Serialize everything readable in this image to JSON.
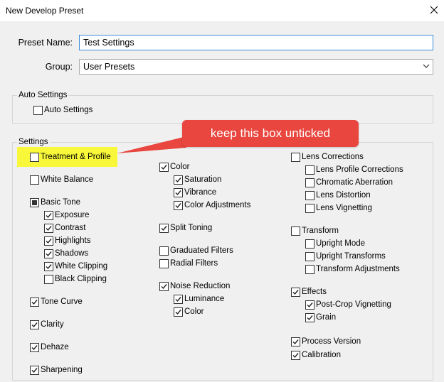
{
  "window": {
    "title": "New Develop Preset"
  },
  "preset_name": {
    "label": "Preset Name:",
    "value": "Test Settings"
  },
  "group": {
    "label": "Group:",
    "value": "User Presets"
  },
  "auto_settings": {
    "legend": "Auto Settings",
    "checkbox": {
      "label": "Auto Settings",
      "checked": false
    }
  },
  "settings": {
    "legend": "Settings",
    "col1": [
      {
        "label": "Treatment & Profile",
        "state": "unchecked"
      },
      {
        "label": "White Balance",
        "state": "unchecked"
      },
      {
        "label": "Basic Tone",
        "state": "partial"
      },
      {
        "label": "Exposure",
        "state": "checked"
      },
      {
        "label": "Contrast",
        "state": "checked"
      },
      {
        "label": "Highlights",
        "state": "checked"
      },
      {
        "label": "Shadows",
        "state": "checked"
      },
      {
        "label": "White Clipping",
        "state": "checked"
      },
      {
        "label": "Black Clipping",
        "state": "unchecked"
      },
      {
        "label": "Tone Curve",
        "state": "checked"
      },
      {
        "label": "Clarity",
        "state": "checked"
      },
      {
        "label": "Dehaze",
        "state": "checked"
      },
      {
        "label": "Sharpening",
        "state": "checked"
      }
    ],
    "col2": [
      {
        "label": "Color",
        "state": "checked"
      },
      {
        "label": "Saturation",
        "state": "checked"
      },
      {
        "label": "Vibrance",
        "state": "checked"
      },
      {
        "label": "Color Adjustments",
        "state": "checked"
      },
      {
        "label": "Split Toning",
        "state": "checked"
      },
      {
        "label": "Graduated Filters",
        "state": "unchecked"
      },
      {
        "label": "Radial Filters",
        "state": "unchecked"
      },
      {
        "label": "Noise Reduction",
        "state": "checked"
      },
      {
        "label": "Luminance",
        "state": "checked"
      },
      {
        "label": "Color",
        "state": "checked"
      }
    ],
    "col3": [
      {
        "label": "Lens Corrections",
        "state": "unchecked"
      },
      {
        "label": "Lens Profile Corrections",
        "state": "unchecked"
      },
      {
        "label": "Chromatic Aberration",
        "state": "unchecked"
      },
      {
        "label": "Lens Distortion",
        "state": "unchecked"
      },
      {
        "label": "Lens Vignetting",
        "state": "unchecked"
      },
      {
        "label": "Transform",
        "state": "unchecked"
      },
      {
        "label": "Upright Mode",
        "state": "unchecked"
      },
      {
        "label": "Upright Transforms",
        "state": "unchecked"
      },
      {
        "label": "Transform Adjustments",
        "state": "unchecked"
      },
      {
        "label": "Effects",
        "state": "checked"
      },
      {
        "label": "Post-Crop Vignetting",
        "state": "checked"
      },
      {
        "label": "Grain",
        "state": "checked"
      },
      {
        "label": "Process Version",
        "state": "checked"
      },
      {
        "label": "Calibration",
        "state": "checked"
      }
    ]
  },
  "annotation": {
    "text": "keep this box unticked",
    "callout_color": "#e8463e",
    "highlight_color": "#f8f73a"
  },
  "icons": {
    "close": "close-icon",
    "dropdown": "chevron-down-icon",
    "check": "checkmark-icon"
  },
  "colors": {
    "focus_border": "#3a8bd9",
    "window_bg": "#f0f0f0"
  }
}
